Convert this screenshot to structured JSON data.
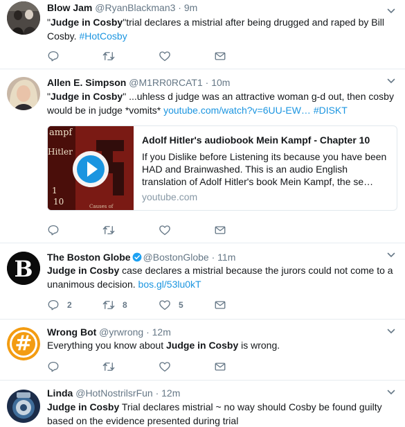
{
  "tweets": [
    {
      "name": "Blow Jam",
      "handle": "@RyanBlackman3",
      "time": "9m",
      "text": {
        "q1": "\"",
        "bold": "Judge in Cosby",
        "rest": "\"trial declares a mistrial after being drugged and raped by Bill Cosby. ",
        "hashtag": "#HotCosby"
      }
    },
    {
      "name": "Allen E. Simpson",
      "handle": "@M1RR0RCAT1",
      "time": "10m",
      "text": {
        "q1": "\"",
        "bold": "Judge in Cosby",
        "rest": "\" ...uhless d judge was an attractive woman g-d out, then cosby would be in judge *vomits* ",
        "url": "youtube.com/watch?v=6UU-EW…",
        "hashtag": "#DISKT"
      },
      "card": {
        "title": "Adolf Hitler's audiobook Mein Kampf - Chapter 10",
        "description": "If you Dislike before Listening its because you have been HAD and Brainwashed. This is an audio English translation of Adolf Hitler's book Mein Kampf, the se…",
        "domain": "youtube.com",
        "thumb_text": {
          "top": "ampf",
          "mid": "Hitler",
          "num1": "1",
          "num2": "10",
          "bottom": "Causes of"
        }
      }
    },
    {
      "name": "The Boston Globe",
      "handle": "@BostonGlobe",
      "time": "11m",
      "verified": true,
      "avatar_letter": "B",
      "text": {
        "bold": "Judge in Cosby",
        "rest": " case declares a mistrial because the jurors could not come to a unanimous decision. ",
        "url": "bos.gl/53lu0kT"
      },
      "counts": {
        "replies": "2",
        "retweets": "8",
        "likes": "5"
      }
    },
    {
      "name": "Wrong Bot",
      "handle": "@yrwrong",
      "time": "12m",
      "avatar_symbol": "#",
      "text": {
        "pre": "Everything you know about ",
        "bold": "Judge in Cosby",
        "rest": " is wrong."
      }
    },
    {
      "name": "Linda",
      "handle": "@HotNostrilsrFun",
      "time": "12m",
      "text": {
        "bold": "Judge in Cosby",
        "rest": " Trial declares mistrial ~ no way should Cosby be found guilty based on the evidence presented during trial"
      }
    }
  ],
  "sep": "·",
  "colors": {
    "link": "#1b95e0",
    "muted": "#657786",
    "border": "#e6ecf0",
    "verified": "#1da1f2",
    "bot_orange": "#f39c12"
  }
}
